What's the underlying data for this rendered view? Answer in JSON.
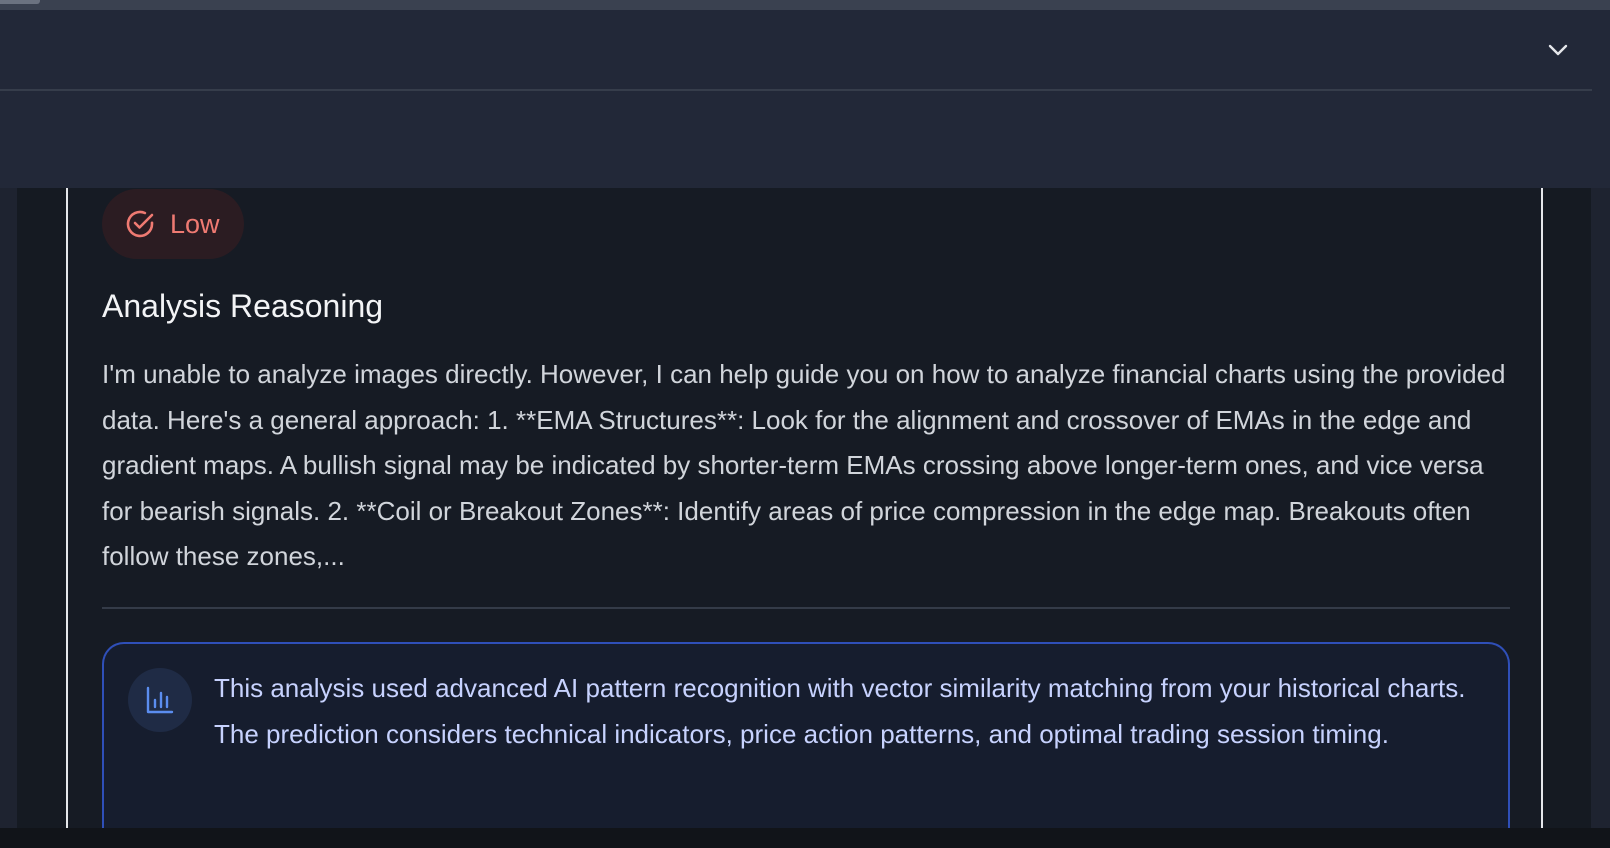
{
  "header": {
    "collapse_icon": "chevron-down-icon"
  },
  "badge": {
    "icon": "check-circle-icon",
    "label": "Low",
    "color": "#ef7a72"
  },
  "analysis": {
    "heading": "Analysis Reasoning",
    "text": "I'm unable to analyze images directly. However, I can help guide you on how to analyze financial charts using the provided data. Here's a general approach: 1. **EMA Structures**: Look for the alignment and crossover of EMAs in the edge and gradient maps. A bullish signal may be indicated by shorter-term EMAs crossing above longer-term ones, and vice versa for bearish signals. 2. **Coil or Breakout Zones**: Identify areas of price compression in the edge map. Breakouts often follow these zones,..."
  },
  "info": {
    "icon": "bar-chart-icon",
    "text": "This analysis used advanced AI pattern recognition with vector similarity matching from your historical charts. The prediction considers technical indicators, price action patterns, and optimal trading session timing.",
    "accent": "#2f4fb8"
  }
}
